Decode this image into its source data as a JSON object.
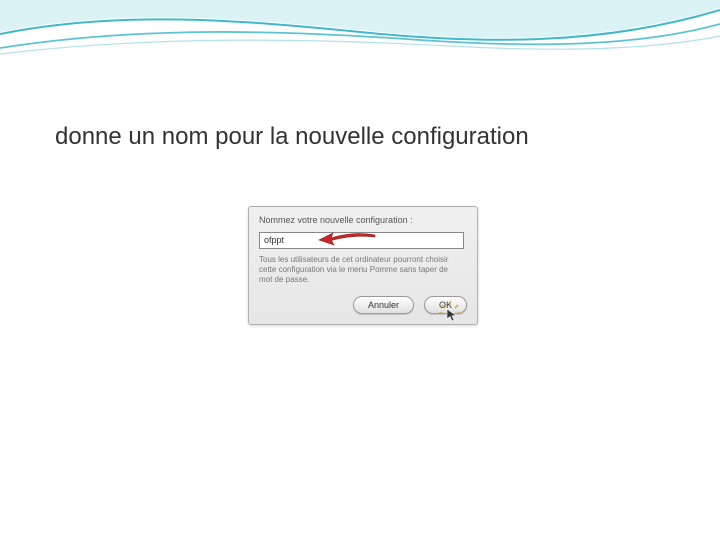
{
  "slide": {
    "title": "donne un nom pour la nouvelle configuration"
  },
  "dialog": {
    "prompt_label": "Nommez votre nouvelle configuration :",
    "input_value": "ofppt",
    "help_text": "Tous les utilisateurs de cet ordinateur pourront choisir cette configuration via le menu Pomme sans taper de mot de passe.",
    "cancel_label": "Annuler",
    "ok_label": "OK"
  },
  "icons": {
    "arrow": "red-arrow-left",
    "click_cursor": "cursor-pointer-click"
  },
  "colors": {
    "wave_accent": "#3fb8cc",
    "arrow": "#c62828"
  }
}
